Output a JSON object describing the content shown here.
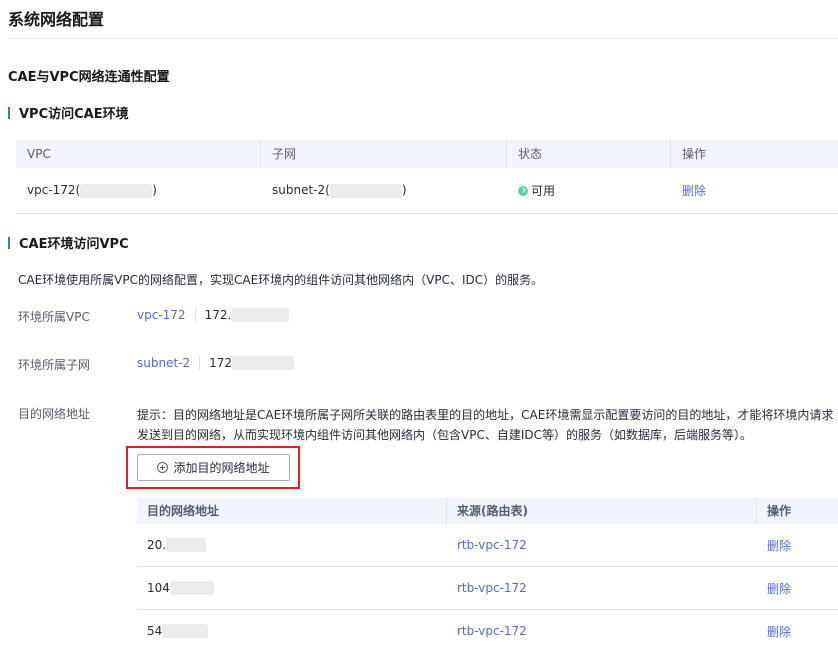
{
  "page": {
    "title": "系统网络配置"
  },
  "section": {
    "title": "CAE与VPC网络连通性配置"
  },
  "vpc_access": {
    "heading": "VPC访问CAE环境",
    "columns": [
      "VPC",
      "子网",
      "状态",
      "操作"
    ],
    "row": {
      "vpc_prefix": "vpc-172(",
      "vpc_suffix": ")",
      "subnet_prefix": "subnet-2(",
      "subnet_suffix": ")",
      "status": "可用",
      "action": "删除"
    }
  },
  "cae_access": {
    "heading": "CAE环境访问VPC",
    "description": "CAE环境使用所属VPC的网络配置，实现CAE环境内的组件访问其他网络内（VPC、IDC）的服务。",
    "env_vpc": {
      "label": "环境所属VPC",
      "link": "vpc-172",
      "value": "172."
    },
    "env_subnet": {
      "label": "环境所属子网",
      "link": "subnet-2",
      "value": "172"
    },
    "dest": {
      "label": "目的网络地址",
      "tip_line1": "提示：目的网络地址是CAE环境所属子网所关联的路由表里的目的地址，CAE环境需显示配置要访问的目的地址，才能将环境内请求",
      "tip_line2": "发送到目的网络，从而实现环境内组件访问其他网络内（包含VPC、自建IDC等）的服务（如数据库，后端服务等）。",
      "add_button": "添加目的网络地址",
      "columns": [
        "目的网络地址",
        "来源(路由表)",
        "操作"
      ],
      "rows": [
        {
          "address": "20.",
          "source": "rtb-vpc-172",
          "action": "删除"
        },
        {
          "address": "104",
          "source": "rtb-vpc-172",
          "action": "删除"
        },
        {
          "address": "54",
          "source": "rtb-vpc-172",
          "action": "删除"
        }
      ]
    }
  },
  "colors": {
    "accent": "#526ecc",
    "highlight": "#e02020",
    "status_ok": "#50d4ab"
  },
  "icons": {
    "status": "check-circle-icon",
    "add": "plus-circle-icon"
  }
}
